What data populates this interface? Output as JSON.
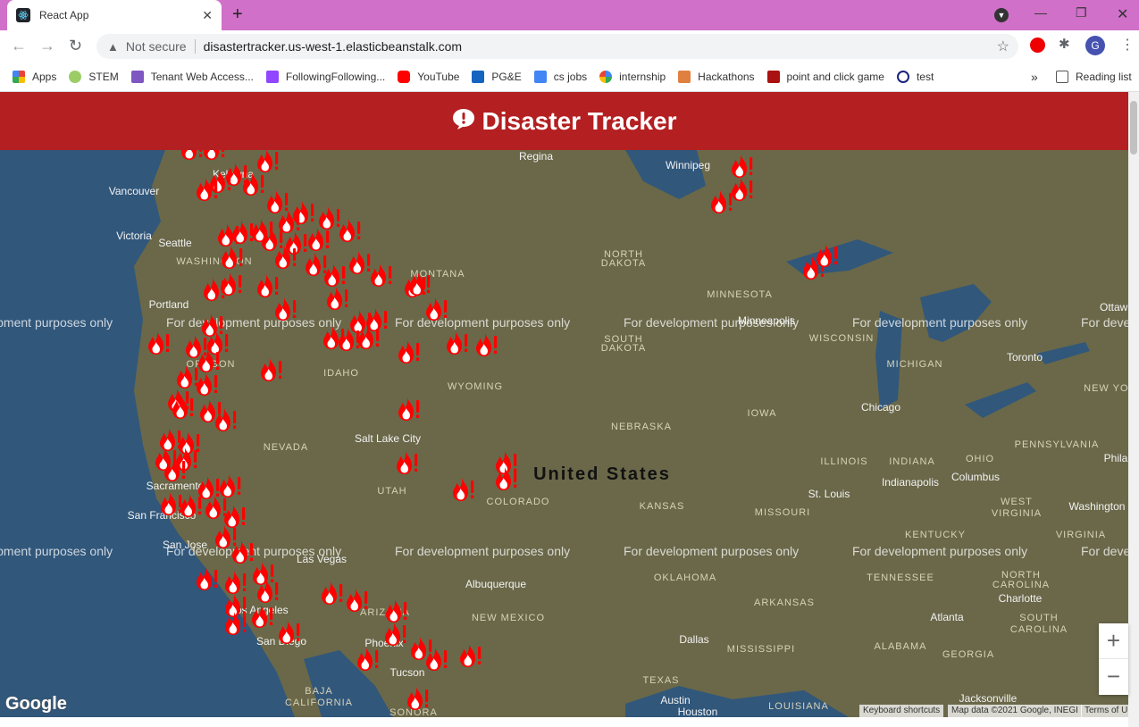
{
  "browser": {
    "tab_title": "React App",
    "url_security": "Not secure",
    "url": "disastertracker.us-west-1.elasticbeanstalk.com",
    "profile_initial": "G",
    "bookmarks": [
      "Apps",
      "STEM",
      "Tenant Web Access...",
      "FollowingFollowing...",
      "YouTube",
      "PG&E",
      "cs jobs",
      "internship",
      "Hackathons",
      "point and click game",
      "test"
    ],
    "reading_list": "Reading list",
    "more": "»"
  },
  "header": {
    "title": "Disaster Tracker"
  },
  "map": {
    "watermark": "For development purposes only",
    "country_label": "United States",
    "labels": [
      {
        "text": "Regina",
        "cls": "city"
      },
      {
        "text": "Winnipeg",
        "cls": "city"
      },
      {
        "text": "Kelowna",
        "cls": "city"
      },
      {
        "text": "Vancouver",
        "cls": "city"
      },
      {
        "text": "Victoria",
        "cls": "city"
      },
      {
        "text": "Seattle",
        "cls": "city"
      },
      {
        "text": "WASHINGTON",
        "cls": "state"
      },
      {
        "text": "Portland",
        "cls": "city"
      },
      {
        "text": "OREGON",
        "cls": "state"
      },
      {
        "text": "IDAHO",
        "cls": "state"
      },
      {
        "text": "MONTANA",
        "cls": "state"
      },
      {
        "text": "NORTH",
        "cls": "state"
      },
      {
        "text": "DAKOTA",
        "cls": "state"
      },
      {
        "text": "SOUTH",
        "cls": "state"
      },
      {
        "text": "DAKOTA",
        "cls": "state"
      },
      {
        "text": "MINNESOTA",
        "cls": "state"
      },
      {
        "text": "Minneapolis",
        "cls": "city"
      },
      {
        "text": "WISCONSIN",
        "cls": "state"
      },
      {
        "text": "MICHIGAN",
        "cls": "state"
      },
      {
        "text": "Ottawa",
        "cls": "city"
      },
      {
        "text": "Toronto",
        "cls": "city"
      },
      {
        "text": "NEW YORK",
        "cls": "state"
      },
      {
        "text": "WYOMING",
        "cls": "state"
      },
      {
        "text": "IOWA",
        "cls": "state"
      },
      {
        "text": "Chicago",
        "cls": "city"
      },
      {
        "text": "NEBRASKA",
        "cls": "state"
      },
      {
        "text": "Salt Lake City",
        "cls": "city"
      },
      {
        "text": "NEVADA",
        "cls": "state"
      },
      {
        "text": "UTAH",
        "cls": "state"
      },
      {
        "text": "COLORADO",
        "cls": "state"
      },
      {
        "text": "KANSAS",
        "cls": "state"
      },
      {
        "text": "ILLINOIS",
        "cls": "state"
      },
      {
        "text": "INDIANA",
        "cls": "state"
      },
      {
        "text": "OHIO",
        "cls": "state"
      },
      {
        "text": "Indianapolis",
        "cls": "city"
      },
      {
        "text": "Columbus",
        "cls": "city"
      },
      {
        "text": "PENNSYLVANIA",
        "cls": "state"
      },
      {
        "text": "Phila",
        "cls": "city"
      },
      {
        "text": "Sacramento",
        "cls": "city"
      },
      {
        "text": "San Francisco",
        "cls": "city"
      },
      {
        "text": "San Jose",
        "cls": "city"
      },
      {
        "text": "MISSOURI",
        "cls": "state"
      },
      {
        "text": "St. Louis",
        "cls": "city"
      },
      {
        "text": "WEST",
        "cls": "state"
      },
      {
        "text": "VIRGINIA",
        "cls": "state"
      },
      {
        "text": "Washington",
        "cls": "city"
      },
      {
        "text": "VIRGINIA",
        "cls": "state"
      },
      {
        "text": "KENTUCKY",
        "cls": "state"
      },
      {
        "text": "Las Vegas",
        "cls": "city"
      },
      {
        "text": "Albuquerque",
        "cls": "city"
      },
      {
        "text": "OKLAHOMA",
        "cls": "state"
      },
      {
        "text": "TENNESSEE",
        "cls": "state"
      },
      {
        "text": "NORTH",
        "cls": "state"
      },
      {
        "text": "CAROLINA",
        "cls": "state"
      },
      {
        "text": "Charlotte",
        "cls": "city"
      },
      {
        "text": "Los Angeles",
        "cls": "city"
      },
      {
        "text": "ARIZONA",
        "cls": "state"
      },
      {
        "text": "NEW MEXICO",
        "cls": "state"
      },
      {
        "text": "ARKANSAS",
        "cls": "state"
      },
      {
        "text": "Atlanta",
        "cls": "city"
      },
      {
        "text": "SOUTH",
        "cls": "state"
      },
      {
        "text": "CAROLINA",
        "cls": "state"
      },
      {
        "text": "San Diego",
        "cls": "city"
      },
      {
        "text": "Phoenix",
        "cls": "city"
      },
      {
        "text": "Dallas",
        "cls": "city"
      },
      {
        "text": "MISSISSIPPI",
        "cls": "state"
      },
      {
        "text": "ALABAMA",
        "cls": "state"
      },
      {
        "text": "GEORGIA",
        "cls": "state"
      },
      {
        "text": "Tucson",
        "cls": "city"
      },
      {
        "text": "TEXAS",
        "cls": "state"
      },
      {
        "text": "Austin",
        "cls": "city"
      },
      {
        "text": "LOUISIANA",
        "cls": "state"
      },
      {
        "text": "Jacksonville",
        "cls": "city"
      },
      {
        "text": "BAJA",
        "cls": "state"
      },
      {
        "text": "CALIFORNIA",
        "cls": "state"
      },
      {
        "text": "Houston",
        "cls": "city"
      },
      {
        "text": "SONORA",
        "cls": "state"
      }
    ],
    "google": "Google",
    "keyboard": "Keyboard shortcuts",
    "map_data": "Map data ©2021 Google, INEGI",
    "terms": "Terms of U",
    "zoom_in": "+",
    "zoom_out": "−"
  },
  "colors": {
    "header": "#b41f21",
    "marker": "#ff0000",
    "tabstrip": "#d070c8"
  }
}
